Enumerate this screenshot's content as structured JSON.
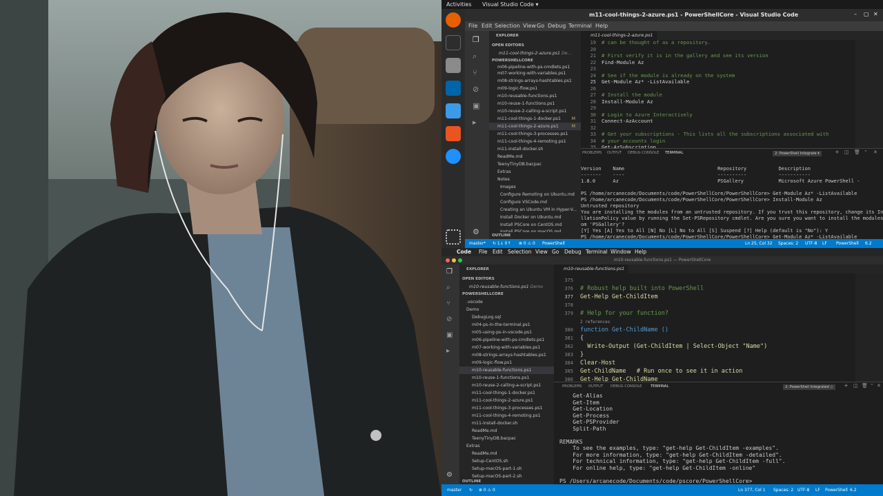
{
  "colors": {
    "accent": "#007acc",
    "comment": "#6a9955",
    "keyword": "#569cd6",
    "function": "#dcdcaa",
    "string": "#ce9178"
  },
  "ubuntu": {
    "activities": "Activities",
    "app_menu": "Visual Studio Code ▾",
    "dock_icons": [
      "firefox-icon",
      "terminal-icon",
      "files-icon",
      "vscode-icon",
      "azure-icon",
      "software-icon",
      "help-icon",
      "apps-grid-icon"
    ]
  },
  "top": {
    "window_title": "m11-cool-things-2-azure.ps1 - PowerShellCore - Visual Studio Code",
    "menu": [
      "File",
      "Edit",
      "Selection",
      "View",
      "Go",
      "Debug",
      "Terminal",
      "Help"
    ],
    "explorer_label": "EXPLORER",
    "open_editors_label": "OPEN EDITORS",
    "open_editor_file": "m11-cool-things-2-azure.ps1",
    "open_editor_folder": "De...",
    "project_label": "POWERSHELLCORE",
    "files": [
      "m06-pipeline-with-ps-cmdlets.ps1",
      "m07-working-with-variables.ps1",
      "m08-strings-arrays-hashtables.ps1",
      "m09-logic-flow.ps1",
      "m10-reusable-functions.ps1",
      "m10-reuse-1-functions.ps1",
      "m10-reuse-2-calling-a-script.ps1",
      "m11-cool-things-1-docker.ps1",
      "m11-cool-things-2-azure.ps1",
      "m11-cool-things-3-processes.ps1",
      "m11-cool-things-4-remoting.ps1",
      "m11-install-docker.sh",
      "ReadMe.md",
      "TeenyTinyDB.bacpac"
    ],
    "modified_badge": "M",
    "folder_extras": "Extras",
    "folder_notes": "Notes",
    "folder_images": "Images",
    "notes_files": [
      "Configure Remoting on Ubuntu.md",
      "Configure VSCode.md",
      "Creating an Ubuntu VM in Hyper-V...",
      "Install Docker on Ubuntu.md",
      "Install PSCore on CentOS.md",
      "Install PSCore on macOS.md"
    ],
    "outline_label": "OUTLINE",
    "tab": "m11-cool-things-2-azure.ps1",
    "line_numbers": [
      "19",
      "20",
      "21",
      "22",
      "23",
      "24",
      "25",
      "26",
      "27",
      "28",
      "29",
      "30",
      "31",
      "32",
      "33",
      "34",
      "35"
    ],
    "code": [
      "# can be thought of as a repository.",
      "",
      "# First verify it is in the gallery and see its version",
      "Find-Module Az",
      "",
      "# See if the module is already on the system",
      "Get-Module Az* -ListAvailable",
      "",
      "# Install the module",
      "Install-Module Az",
      "",
      "# Login to Azure Interactively",
      "Connect-AzAccount",
      "",
      "# Get your subscriptions - This lists all the subscriptions associated with",
      "# your accounts login",
      "Get-AzSubscription"
    ],
    "panel_tabs": [
      "PROBLEMS",
      "OUTPUT",
      "DEBUG CONSOLE",
      "TERMINAL"
    ],
    "terminal_select": "2: PowerShell Integrate ▾",
    "terminal_lines": [
      "Version    Name                                Repository           Description",
      "-------    ----                                ----------           -----------",
      "1.8.0      Az                                  PSGallery            Microsoft Azure PowerShell -",
      "",
      "PS /home/arcanecode/Documents/code/PowerShellCore/PowerShellCore> Get-Module Az* -ListAvailable",
      "PS /home/arcanecode/Documents/code/PowerShellCore/PowerShellCore> Install-Module Az",
      "Untrusted repository",
      "You are installing the modules from an untrusted repository. If you trust this repository, change its Insta",
      "llationPolicy value by running the Set-PSRepository cmdlet. Are you sure you want to install the modules fr",
      "om 'PSGallery'?",
      "[Y] Yes [A] Yes to All [N] No [L] No to All [S] Suspend [?] Help (default is \"No\"): Y",
      "PS /home/arcanecode/Documents/code/PowerShellCore/PowerShellCore> Get-Module Az* -ListAvailable"
    ],
    "status": {
      "branch": "master*",
      "sync": "↻ 1↓ 0↑",
      "errors": "⊗ 0 ⚠ 0",
      "lang_tag": "PowerShell",
      "pos": "Ln 25, Col 32",
      "spaces": "Spaces: 2",
      "enc": "UTF-8",
      "eol": "LF",
      "lang": "PowerShell",
      "ver": "6.2"
    }
  },
  "mac": {
    "apple": "",
    "app": "Code",
    "menu": [
      "File",
      "Edit",
      "Selection",
      "View",
      "Go",
      "Debug",
      "Terminal",
      "Window",
      "Help"
    ],
    "window_title": "m10-reusable-functions.ps1 — PowerShellCore",
    "explorer_label": "EXPLORER",
    "open_editors_label": "OPEN EDITORS",
    "open_editor_file": "m10-reusable-functions.ps1",
    "open_editor_folder": "Demo",
    "project_label": "POWERSHELLCORE",
    "files": [
      ".vscode",
      "Demo",
      "DebugLog.sql",
      "m04-ps-in-the-terminal.ps1",
      "m05-using-ps-in-vscode.ps1",
      "m06-pipeline-with-ps-cmdlets.ps1",
      "m07-working-with-variables.ps1",
      "m08-strings-arrays-hashtables.ps1",
      "m09-logic-flow.ps1",
      "m10-reusable-functions.ps1",
      "m10-reuse-1-functions.ps1",
      "m10-reuse-2-calling-a-script.ps1",
      "m11-cool-things-1-docker.ps1",
      "m11-cool-things-2-azure.ps1",
      "m11-cool-things-3-processes.ps1",
      "m11-cool-things-4-remoting.ps1",
      "m11-install-docker.sh",
      "ReadMe.md",
      "TeenyTinyDB.bacpac",
      "Extras",
      "ReadMe.md",
      "Setup-CentOS.sh",
      "Setup-macOS-part-1.sh",
      "Setup-macOS-part-2.sh"
    ],
    "outline_label": "OUTLINE",
    "tab": "m10-reusable-functions.ps1",
    "line_numbers": [
      "375",
      "376",
      "377",
      "378",
      "379",
      "",
      "380",
      "381",
      "382",
      "383",
      "384",
      "385",
      "386"
    ],
    "code": [
      "",
      "# Robust help built into PowerShell",
      "Get-Help Get-ChildItem",
      "",
      "# Help for your function?",
      "2 references",
      "function Get-ChildName ()",
      "{",
      "  Write-Output (Get-ChildItem | Select-Object \"Name\")",
      "}",
      "Clear-Host",
      "Get-ChildName   # Run once to see it in action",
      "Get-Help Get-ChildName"
    ],
    "panel_tabs": [
      "PROBLEMS",
      "OUTPUT",
      "DEBUG CONSOLE",
      "TERMINAL"
    ],
    "terminal_select": "2: PowerShell Integrated ◇",
    "terminal_lines": [
      "    Get-Alias",
      "    Get-Item",
      "    Get-Location",
      "    Get-Process",
      "    Get-PSProvider",
      "    Split-Path",
      "",
      "REMARKS",
      "    To see the examples, type: \"get-help Get-ChildItem -examples\".",
      "    For more information, type: \"get-help Get-ChildItem -detailed\".",
      "    For technical information, type: \"get-help Get-ChildItem -full\".",
      "    For online help, type: \"get-help Get-ChildItem -online\"",
      "",
      "PS /Users/arcanecode/Documents/code/pscore/PowerShellCore> "
    ],
    "status": {
      "branch": "master",
      "sync": "↻",
      "errors": "⊗ 0 ⚠ 0",
      "pos": "Ln 377, Col 1",
      "spaces": "Spaces: 2",
      "enc": "UTF-8",
      "eol": "LF",
      "lang": "PowerShell",
      "ver": "6.2"
    }
  }
}
